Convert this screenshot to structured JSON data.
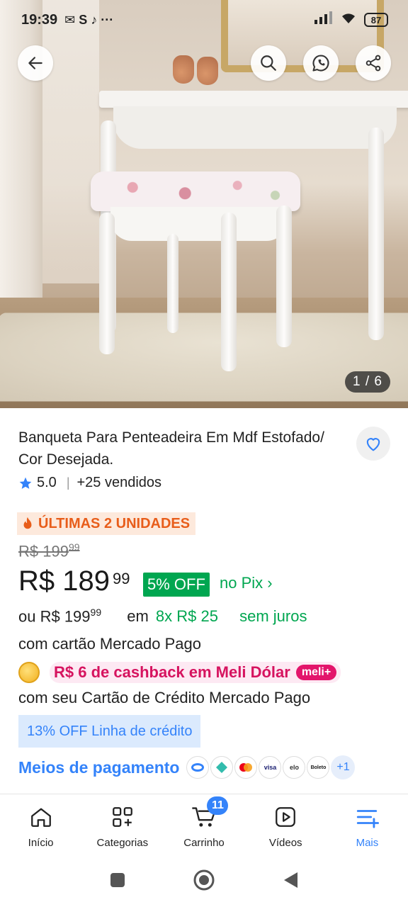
{
  "status_bar": {
    "time": "19:39",
    "battery": "87"
  },
  "gallery": {
    "counter": "1 / 6"
  },
  "product": {
    "title": "Banqueta Para Penteadeira Em Mdf Estofado/ Cor Desejada.",
    "rating": "5.0",
    "sold": "+25 vendidos",
    "stock_badge": "ÚLTIMAS 2 UNIDADES"
  },
  "pricing": {
    "old_price_int": "R$ 199",
    "old_price_cents": "99",
    "price_int": "R$ 189",
    "price_cents": "99",
    "discount": "5% OFF",
    "pix_label": "no Pix ›",
    "installment_prefix": "ou R$ 199",
    "installment_cents": "99",
    "installment_in": "em",
    "installment_count": "8x R$ 25",
    "installment_interest": "sem juros",
    "card_line": "com cartão Mercado Pago"
  },
  "cashback": {
    "text": "R$ 6 de cashback em Meli Dólar",
    "badge": "meli+",
    "subtext": "com seu Cartão de Crédito Mercado Pago"
  },
  "credit_line": "13% OFF Linha de crédito",
  "payment": {
    "label": "Meios de pagamento",
    "methods": [
      "visa",
      "elo",
      "Boleto"
    ],
    "more": "+1"
  },
  "bottom_nav": {
    "items": [
      {
        "label": "Início",
        "icon": "home-icon"
      },
      {
        "label": "Categorias",
        "icon": "categories-icon"
      },
      {
        "label": "Carrinho",
        "icon": "cart-icon"
      },
      {
        "label": "Vídeos",
        "icon": "video-icon"
      },
      {
        "label": "Mais",
        "icon": "menu-icon"
      }
    ],
    "cart_count": "11"
  },
  "colors": {
    "accent_blue": "#3483fa",
    "green": "#00a650",
    "orange": "#e85d1a",
    "pink": "#d6135f"
  }
}
